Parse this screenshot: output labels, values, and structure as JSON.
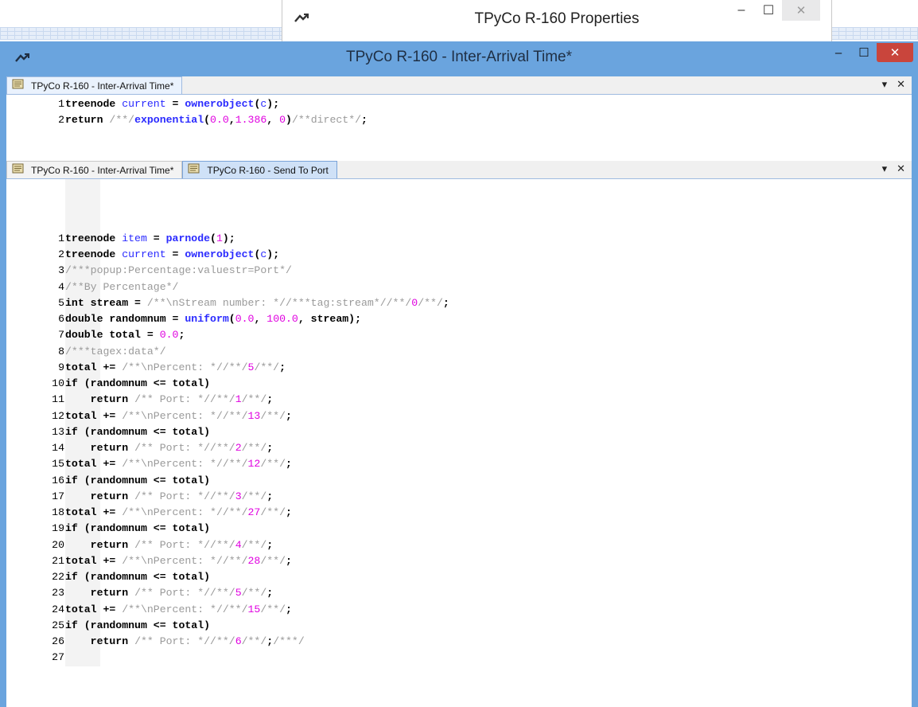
{
  "properties_window": {
    "title": "TPyCo R-160  Properties",
    "minimize": "–",
    "maximize": "☐",
    "close": "✕"
  },
  "main_window": {
    "title": "TPyCo R-160 - Inter-Arrival Time*",
    "minimize": "–",
    "maximize": "☐",
    "close": "✕"
  },
  "top_pane": {
    "tab_label": "TPyCo R-160 - Inter-Arrival Time*",
    "menu_glyph": "▾",
    "close_glyph": "✕",
    "lines": [
      {
        "n": "1",
        "segs": [
          [
            "kw",
            "treenode "
          ],
          [
            "id",
            "current"
          ],
          [
            "op",
            " = "
          ],
          [
            "fn",
            "ownerobject"
          ],
          [
            "op",
            "("
          ],
          [
            "id",
            "c"
          ],
          [
            "op",
            ");"
          ]
        ]
      },
      {
        "n": "2",
        "segs": [
          [
            "kw",
            "return "
          ],
          [
            "cm",
            "/**/"
          ],
          [
            "fn",
            "exponential"
          ],
          [
            "op",
            "("
          ],
          [
            "num",
            "0.0"
          ],
          [
            "op",
            ","
          ],
          [
            "num",
            "1.386"
          ],
          [
            "op",
            ", "
          ],
          [
            "num",
            "0"
          ],
          [
            "op",
            ")"
          ],
          [
            "cm",
            "/**direct*/"
          ],
          [
            "op",
            ";"
          ]
        ]
      }
    ]
  },
  "bottom_pane": {
    "tabs": [
      {
        "label": "TPyCo R-160 - Inter-Arrival Time*",
        "state": "inactive"
      },
      {
        "label": "TPyCo R-160 - Send To Port",
        "state": "selected"
      }
    ],
    "menu_glyph": "▾",
    "close_glyph": "✕",
    "lines": [
      {
        "n": "1",
        "segs": [
          [
            "kw",
            "treenode "
          ],
          [
            "id",
            "item"
          ],
          [
            "op",
            " = "
          ],
          [
            "fn",
            "parnode"
          ],
          [
            "op",
            "("
          ],
          [
            "num",
            "1"
          ],
          [
            "op",
            ");"
          ]
        ]
      },
      {
        "n": "2",
        "segs": [
          [
            "kw",
            "treenode "
          ],
          [
            "id",
            "current"
          ],
          [
            "op",
            " = "
          ],
          [
            "fn",
            "ownerobject"
          ],
          [
            "op",
            "("
          ],
          [
            "id",
            "c"
          ],
          [
            "op",
            ");"
          ]
        ]
      },
      {
        "n": "3",
        "segs": [
          [
            "cm",
            "/***popup:Percentage:valuestr=Port*/"
          ]
        ]
      },
      {
        "n": "4",
        "segs": [
          [
            "cm",
            "/**By Percentage*/"
          ]
        ]
      },
      {
        "n": "5",
        "segs": [
          [
            "kw",
            "int stream = "
          ],
          [
            "cm",
            "/**\\nStream number: *//***tag:stream*//**/"
          ],
          [
            "num",
            "0"
          ],
          [
            "cm",
            "/**/"
          ],
          [
            "op",
            ";"
          ]
        ]
      },
      {
        "n": "6",
        "segs": [
          [
            "kw",
            "double randomnum = "
          ],
          [
            "fn",
            "uniform"
          ],
          [
            "op",
            "("
          ],
          [
            "num",
            "0.0"
          ],
          [
            "op",
            ", "
          ],
          [
            "num",
            "100.0"
          ],
          [
            "op",
            ", stream);"
          ]
        ]
      },
      {
        "n": "7",
        "segs": [
          [
            "kw",
            "double total = "
          ],
          [
            "num",
            "0.0"
          ],
          [
            "op",
            ";"
          ]
        ]
      },
      {
        "n": "8",
        "segs": [
          [
            "cm",
            "/***tagex:data*/"
          ]
        ]
      },
      {
        "n": "9",
        "segs": [
          [
            "kw",
            "total += "
          ],
          [
            "cm",
            "/**\\nPercent: *//**/"
          ],
          [
            "num",
            "5"
          ],
          [
            "cm",
            "/**/"
          ],
          [
            "op",
            ";"
          ]
        ]
      },
      {
        "n": "10",
        "segs": [
          [
            "kw",
            "if (randomnum <= total)"
          ]
        ]
      },
      {
        "n": "11",
        "segs": [
          [
            "kw",
            "    return "
          ],
          [
            "cm",
            "/** Port: *//**/"
          ],
          [
            "num",
            "1"
          ],
          [
            "cm",
            "/**/"
          ],
          [
            "op",
            ";"
          ]
        ]
      },
      {
        "n": "12",
        "segs": [
          [
            "kw",
            "total += "
          ],
          [
            "cm",
            "/**\\nPercent: *//**/"
          ],
          [
            "num",
            "13"
          ],
          [
            "cm",
            "/**/"
          ],
          [
            "op",
            ";"
          ]
        ]
      },
      {
        "n": "13",
        "segs": [
          [
            "kw",
            "if (randomnum <= total)"
          ]
        ]
      },
      {
        "n": "14",
        "segs": [
          [
            "kw",
            "    return "
          ],
          [
            "cm",
            "/** Port: *//**/"
          ],
          [
            "num",
            "2"
          ],
          [
            "cm",
            "/**/"
          ],
          [
            "op",
            ";"
          ]
        ]
      },
      {
        "n": "15",
        "segs": [
          [
            "kw",
            "total += "
          ],
          [
            "cm",
            "/**\\nPercent: *//**/"
          ],
          [
            "num",
            "12"
          ],
          [
            "cm",
            "/**/"
          ],
          [
            "op",
            ";"
          ]
        ]
      },
      {
        "n": "16",
        "segs": [
          [
            "kw",
            "if (randomnum <= total)"
          ]
        ]
      },
      {
        "n": "17",
        "segs": [
          [
            "kw",
            "    return "
          ],
          [
            "cm",
            "/** Port: *//**/"
          ],
          [
            "num",
            "3"
          ],
          [
            "cm",
            "/**/"
          ],
          [
            "op",
            ";"
          ]
        ]
      },
      {
        "n": "18",
        "segs": [
          [
            "kw",
            "total += "
          ],
          [
            "cm",
            "/**\\nPercent: *//**/"
          ],
          [
            "num",
            "27"
          ],
          [
            "cm",
            "/**/"
          ],
          [
            "op",
            ";"
          ]
        ]
      },
      {
        "n": "19",
        "segs": [
          [
            "kw",
            "if (randomnum <= total)"
          ]
        ]
      },
      {
        "n": "20",
        "segs": [
          [
            "kw",
            "    return "
          ],
          [
            "cm",
            "/** Port: *//**/"
          ],
          [
            "num",
            "4"
          ],
          [
            "cm",
            "/**/"
          ],
          [
            "op",
            ";"
          ]
        ]
      },
      {
        "n": "21",
        "segs": [
          [
            "kw",
            "total += "
          ],
          [
            "cm",
            "/**\\nPercent: *//**/"
          ],
          [
            "num",
            "28"
          ],
          [
            "cm",
            "/**/"
          ],
          [
            "op",
            ";"
          ]
        ]
      },
      {
        "n": "22",
        "segs": [
          [
            "kw",
            "if (randomnum <= total)"
          ]
        ]
      },
      {
        "n": "23",
        "segs": [
          [
            "kw",
            "    return "
          ],
          [
            "cm",
            "/** Port: *//**/"
          ],
          [
            "num",
            "5"
          ],
          [
            "cm",
            "/**/"
          ],
          [
            "op",
            ";"
          ]
        ]
      },
      {
        "n": "24",
        "segs": [
          [
            "kw",
            "total += "
          ],
          [
            "cm",
            "/**\\nPercent: *//**/"
          ],
          [
            "num",
            "15"
          ],
          [
            "cm",
            "/**/"
          ],
          [
            "op",
            ";"
          ]
        ]
      },
      {
        "n": "25",
        "segs": [
          [
            "kw",
            "if (randomnum <= total)"
          ]
        ]
      },
      {
        "n": "26",
        "segs": [
          [
            "kw",
            "    return "
          ],
          [
            "cm",
            "/** Port: *//**/"
          ],
          [
            "num",
            "6"
          ],
          [
            "cm",
            "/**/"
          ],
          [
            "op",
            ";"
          ],
          [
            "cm",
            "/***/"
          ]
        ]
      },
      {
        "n": "27",
        "segs": []
      }
    ]
  },
  "colors": {
    "titlebar_active": "#6aa4de",
    "close_button": "#c9453c",
    "keyword": "#000000",
    "identifier": "#2a2aff",
    "number": "#e000e0",
    "comment": "#9a9a9a"
  }
}
